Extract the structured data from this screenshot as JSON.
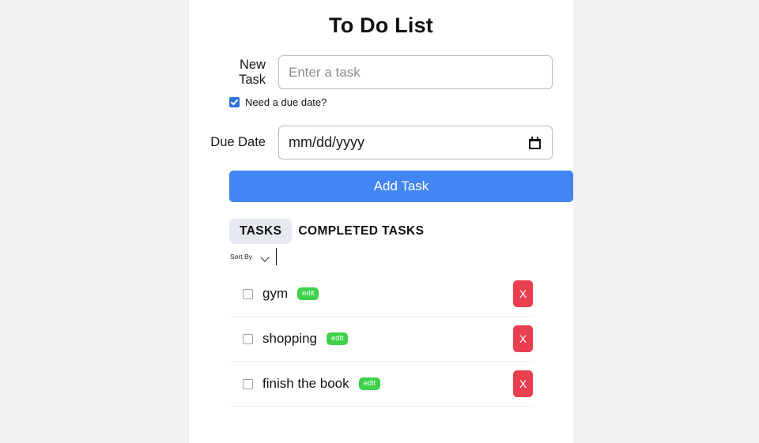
{
  "app": {
    "title": "To Do List",
    "accent_color": "#4285f4",
    "edit_color": "#3ed14a",
    "delete_color": "#e8404f",
    "page_background": "#f1f2f4",
    "card_background": "#ffffff"
  },
  "form": {
    "new_task": {
      "label": "New Task",
      "placeholder": "Enter a task",
      "value": ""
    },
    "due_date_checkbox": {
      "label": "Need a due date?",
      "checked": true
    },
    "due_date": {
      "label": "Due Date",
      "placeholder": "mm/dd/yyyy",
      "value": "",
      "icon": "calendar-icon"
    },
    "add_button": {
      "label": "Add Task"
    }
  },
  "tabs": [
    {
      "label": "TASKS",
      "active": true
    },
    {
      "label": "COMPLETED TASKS",
      "active": false
    }
  ],
  "sort": {
    "label": "Sort By",
    "icon": "chevron-down-icon",
    "value": ""
  },
  "tasks": [
    {
      "text": "gym",
      "checked": false,
      "edit_label": "edit",
      "delete_label": "X"
    },
    {
      "text": "shopping",
      "checked": false,
      "edit_label": "edit",
      "delete_label": "X"
    },
    {
      "text": "finish the book",
      "checked": false,
      "edit_label": "edit",
      "delete_label": "X"
    }
  ]
}
